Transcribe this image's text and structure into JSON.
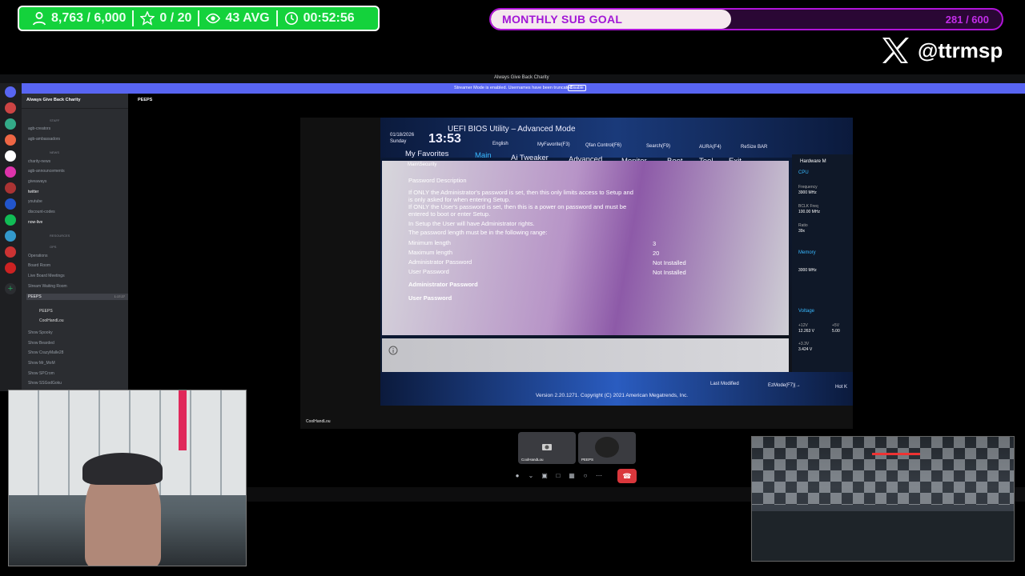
{
  "stats": {
    "followers": "8,763 / 6,000",
    "stars": "0 / 20",
    "viewers": "43 AVG",
    "timer": "00:52:56",
    "accent": "#14d23c"
  },
  "sub_goal": {
    "label": "MONTHLY SUB GOAL",
    "count": "281 / 600",
    "progress": 0.47,
    "accent": "#b014d8"
  },
  "social": {
    "handle": "@ttrmsp",
    "icon": "x-logo-icon"
  },
  "discord": {
    "window_title": "Always Give Back Charity",
    "banner_text": "Streamer Mode is enabled. Usernames have been truncated.",
    "banner_button": "Disable",
    "server_name": "Always Give Back Charity",
    "current_channel": "PEEPS",
    "categories": {
      "staff": "STAFF",
      "news": "NEWS",
      "resources": "RESOURCES",
      "ops": "OPS"
    },
    "channels_top": [
      "agb-creators",
      "agb-ambassadors"
    ],
    "channels_news": [
      "charity-news",
      "agb-announcements",
      "giveaways",
      "twitter",
      "youtube",
      "discount-codes",
      "now-live"
    ],
    "channels_ops": [
      "Operations",
      "Board Room",
      "Live Board Meetings",
      "Stream Waiting Room",
      "PEEPS"
    ],
    "voice_peeps_time": "1:17:27",
    "voice_users": [
      "PEEPS",
      "CoolHandLou"
    ],
    "channels_shows": [
      "Show Spooky",
      "Show Bearded",
      "Show CrazyMalle28",
      "Show Mr_MoM",
      "Show SPCrom",
      "Show SSGodGoku"
    ],
    "video_user": "CoolHandLou",
    "tiles": [
      "CoolHandLou",
      "PEEPS"
    ],
    "blurple": "#5865f2",
    "hangup_color": "#da373c"
  },
  "bios": {
    "title": "UEFI BIOS Utility – Advanced Mode",
    "date": "01/18/2026",
    "day": "Sunday",
    "time": "13:53",
    "toolbar": [
      "English",
      "MyFavorite(F3)",
      "Qfan Control(F6)",
      "Search(F9)",
      "AURA(F4)",
      "ReSize BAR"
    ],
    "menu": [
      "My Favorites",
      "Main",
      "Ai Tweaker",
      "Advanced",
      "Monitor",
      "Boot",
      "Tool",
      "Exit"
    ],
    "breadcrumb": "Main\\Security",
    "section": "Password Description",
    "lines": [
      "If ONLY the Administrator's password is set, then this only limits access to Setup and",
      "is only asked for when entering Setup.",
      "If ONLY the User's password is set, then this is a power on password and must be",
      "entered to boot or enter Setup.",
      "In Setup the User will have Administrator rights.",
      "The password length must be in the following range:"
    ],
    "rows": [
      {
        "label": "Minimum length",
        "value": "3"
      },
      {
        "label": "Maximum length",
        "value": "20"
      },
      {
        "label": "Administrator Password",
        "value": "Not Installed"
      },
      {
        "label": "User Password",
        "value": "Not Installed"
      }
    ],
    "links": [
      "Administrator Password",
      "User Password"
    ],
    "hw_title": "Hardware M",
    "hw": {
      "cpu": "CPU",
      "freq_label": "Frequency",
      "freq": "3900 MHz",
      "bclk_label": "BCLK Freq",
      "bclk": "100.00 MHz",
      "ratio_label": "Ratio",
      "ratio": "39x",
      "mem": "Memory",
      "mem_freq": "3000 MHz",
      "volt": "Voltage",
      "v12": "+12V",
      "v12val": "12.263 V",
      "v5": "+5V",
      "v5val": "5.00",
      "v33": "+3.3V",
      "v33val": "3.424 V"
    },
    "footer": {
      "last_modified": "Last Modified",
      "ezmode": "EzMode(F7)|→",
      "hotkeys": "Hot K",
      "version": "Version 2.20.1271. Copyright (C) 2021 American Megatrends, Inc."
    }
  }
}
